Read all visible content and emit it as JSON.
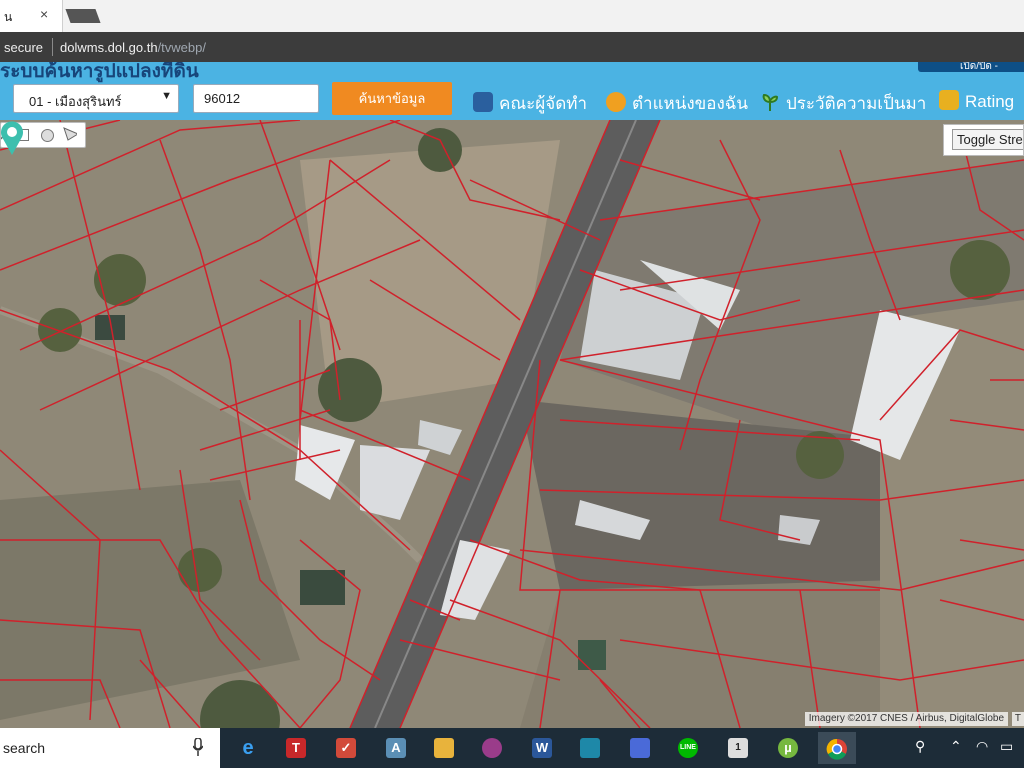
{
  "browser": {
    "tab_title": "น",
    "tab_close": "×",
    "security_label": "secure",
    "url_host": "dolwms.dol.go.th",
    "url_path": "/tvwebp/"
  },
  "site": {
    "title": "ระบบค้นหารูปแปลงที่ดิน",
    "top_right_label": "เปิด/ปิด -",
    "district_select": {
      "value": "01 - เมืองสุรินทร์",
      "arrow": "▼"
    },
    "search_input": {
      "value": "96012"
    },
    "search_button": "ค้นหาข้อมูล",
    "nav": [
      {
        "label": "คณะผู้จัดทำ",
        "icon": "people-icon",
        "color": "#2a5f9e"
      },
      {
        "label": "ตำแหน่งของฉัน",
        "icon": "face-icon",
        "color": "#f0a020"
      },
      {
        "label": "ประวัติความเป็นมา",
        "icon": "sprout-icon",
        "color": "#3e9a2e"
      },
      {
        "label": "Rating",
        "icon": "handshake-icon",
        "color": "#e8b020"
      }
    ]
  },
  "map": {
    "toggle_button": "Toggle Street",
    "attribution": "Imagery ©2017 CNES / Airbus, DigitalGlobe",
    "attribution_tail": "T",
    "parcel_line_color": "#d0212b",
    "marker_color": "#3dbfae"
  },
  "taskbar": {
    "search_text": "search",
    "apps": [
      {
        "name": "edge",
        "glyph": "e",
        "color": "#1f79d4"
      },
      {
        "name": "t-app",
        "glyph": "T",
        "color": "#c8282a"
      },
      {
        "name": "red-app",
        "glyph": "✓",
        "color": "#d24a3a"
      },
      {
        "name": "a-app",
        "glyph": "A",
        "color": "#5b8fb5"
      },
      {
        "name": "file-explorer",
        "glyph": "",
        "color": "#e8b33c"
      },
      {
        "name": "paint-app",
        "glyph": "",
        "color": "#9a3c8a"
      },
      {
        "name": "word",
        "glyph": "W",
        "color": "#2b579a"
      },
      {
        "name": "feather-app",
        "glyph": "",
        "color": "#1e88a8"
      },
      {
        "name": "cube-app",
        "glyph": "",
        "color": "#4a6ad8"
      },
      {
        "name": "line",
        "glyph": "LINE",
        "color": "#00b900"
      },
      {
        "name": "mail",
        "glyph": "1",
        "color": "#dddddd"
      },
      {
        "name": "utorrent",
        "glyph": "µ",
        "color": "#76b83f"
      },
      {
        "name": "chrome",
        "glyph": "",
        "color": "#db4437"
      }
    ]
  }
}
